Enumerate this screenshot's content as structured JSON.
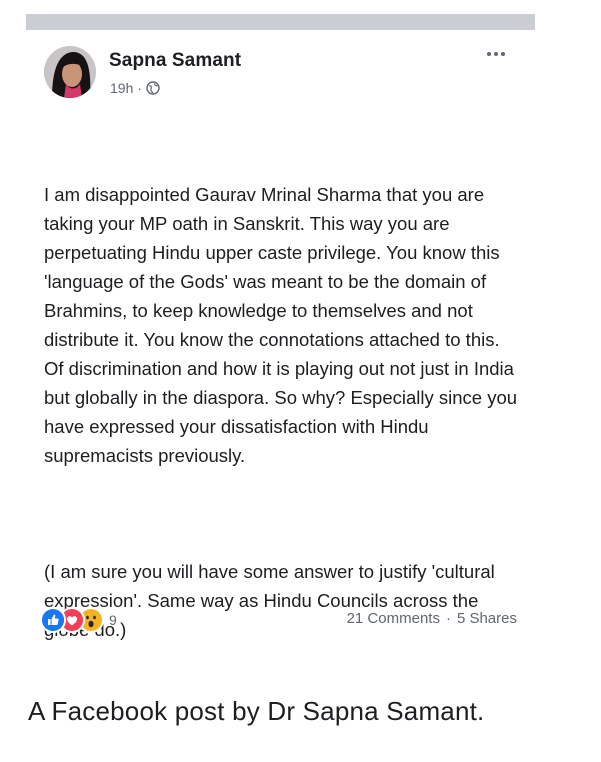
{
  "post": {
    "author": "Sapna Samant",
    "time": "19h",
    "separator": "·",
    "paragraphs": [
      "I am disappointed Gaurav Mrinal Sharma that you are taking your MP oath in Sanskrit. This way you are perpetuating Hindu upper caste privilege. You know this 'language of the Gods' was meant to be the domain of Brahmins, to keep knowledge to themselves and not distribute it. You know the connotations attached to this. Of discrimination and how it is playing out not just in India but globally in the diaspora. So why? Especially since you have expressed your dissatisfaction with Hindu supremacists previously.",
      "(I am sure you will have some answer to justify 'cultural expression'. Same way as Hindu Councils across the globe do.)"
    ],
    "reactions": {
      "icons": [
        "like-icon",
        "love-icon",
        "wow-icon"
      ],
      "count": "9"
    },
    "comments": "21 Comments",
    "shares": "5 Shares",
    "engagement_separator": "·"
  },
  "caption": "A Facebook post by Dr Sapna Samant.",
  "colors": {
    "like": "#1877f2",
    "love": "#f33e58",
    "wow": "#f7b125",
    "top_bar": "#cacdd4"
  }
}
